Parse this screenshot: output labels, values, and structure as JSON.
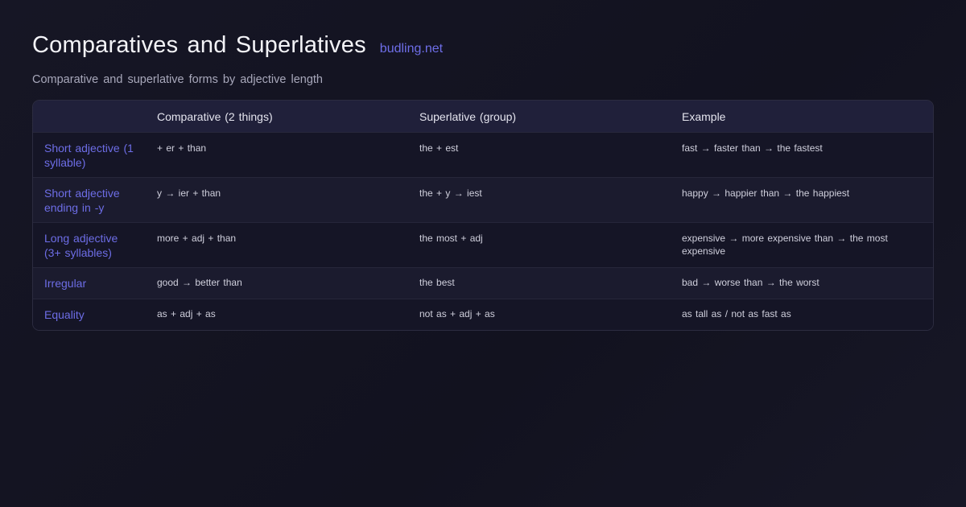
{
  "header": {
    "title": "Comparatives and Superlatives",
    "brand": "budling.net",
    "subtitle": "Comparative and superlative forms by adjective length"
  },
  "table": {
    "columns": [
      "",
      "Comparative (2 things)",
      "Superlative (group)",
      "Example"
    ],
    "rows": [
      {
        "label": "Short adjective (1 syllable)",
        "comparative": "+ er + than",
        "superlative": "the + est",
        "example": "fast → faster than → the fastest"
      },
      {
        "label": "Short adjective ending in -y",
        "comparative": "y → ier + than",
        "superlative": "the + y → iest",
        "example": "happy → happier than → the happiest"
      },
      {
        "label": "Long adjective (3+ syllables)",
        "comparative": "more + adj + than",
        "superlative": "the most + adj",
        "example": "expensive → more expensive than → the most expensive"
      },
      {
        "label": "Irregular",
        "comparative": "good → better than",
        "superlative": "the best",
        "example": "bad → worse than → the worst"
      },
      {
        "label": "Equality",
        "comparative": "as + adj + as",
        "superlative": "not as + adj + as",
        "example": "as tall as / not as fast as"
      }
    ]
  },
  "colors": {
    "background": "#141423",
    "accent": "#6d6de6",
    "header_row": "#20203a"
  }
}
